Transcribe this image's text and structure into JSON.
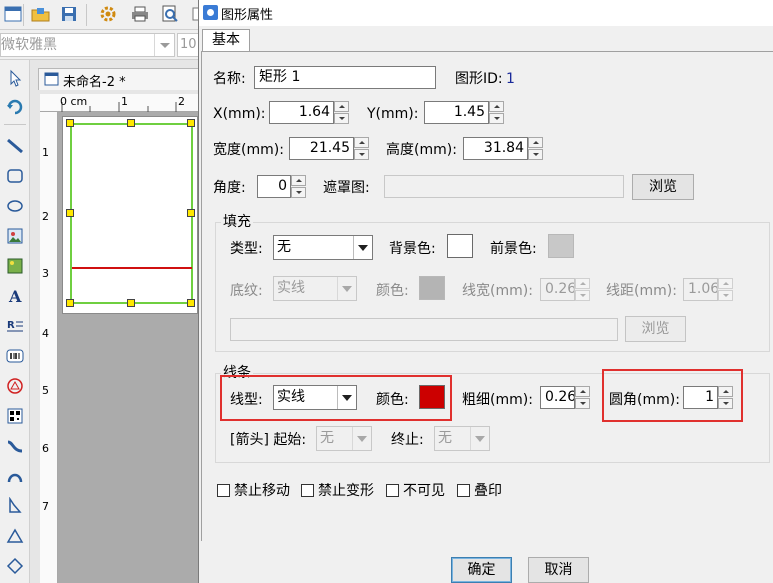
{
  "app": {
    "font_name": "微软雅黑",
    "font_size": "10",
    "document_tab": "未命名-2 *",
    "ruler_h": [
      "0 cm",
      "1",
      "2"
    ],
    "ruler_v": [
      "1",
      "2",
      "3",
      "4",
      "5",
      "6",
      "7"
    ]
  },
  "dialog": {
    "title": "图形属性",
    "tab": "基本",
    "name_label": "名称:",
    "name_value": "矩形 1",
    "id_label": "图形ID:",
    "id_value": "1",
    "x_label": "X(mm):",
    "x_value": "1.64",
    "y_label": "Y(mm):",
    "y_value": "1.45",
    "width_label": "宽度(mm):",
    "width_value": "21.45",
    "height_label": "高度(mm):",
    "height_value": "31.84",
    "angle_label": "角度:",
    "angle_value": "0",
    "mask_label": "遮罩图:",
    "mask_value": "",
    "browse_label": "浏览",
    "fill": {
      "group_title": "填充",
      "type_label": "类型:",
      "type_value": "无",
      "bg_label": "背景色:",
      "fg_label": "前景色:",
      "pattern_label": "底纹:",
      "pattern_value": "实线",
      "color_label": "颜色:",
      "linewidth_label": "线宽(mm):",
      "linewidth_value": "0.26",
      "spacing_label": "线距(mm):",
      "spacing_value": "1.06",
      "image_path": "",
      "browse_label": "浏览",
      "bg_color": "#ffffff",
      "fg_color": "#c8c8c8",
      "pattern_color": "#b4b4b4"
    },
    "line": {
      "group_title": "线条",
      "type_label": "线型:",
      "type_value": "实线",
      "color_label": "颜色:",
      "color": "#cc0000",
      "thickness_label": "粗细(mm):",
      "thickness_value": "0.26",
      "radius_label": "圆角(mm):",
      "radius_value": "1",
      "arrow_label": "[箭头] 起始:",
      "arrow_start_value": "无",
      "arrow_end_label": "终止:",
      "arrow_end_value": "无"
    },
    "checks": {
      "no_move": "禁止移动",
      "no_transform": "禁止变形",
      "invisible": "不可见",
      "overprint": "叠印"
    },
    "ok_label": "确定",
    "cancel_label": "取消"
  },
  "colors": {
    "highlight": "#e0302e",
    "selection_border": "#6fcf40",
    "handle": "#ffe800"
  }
}
